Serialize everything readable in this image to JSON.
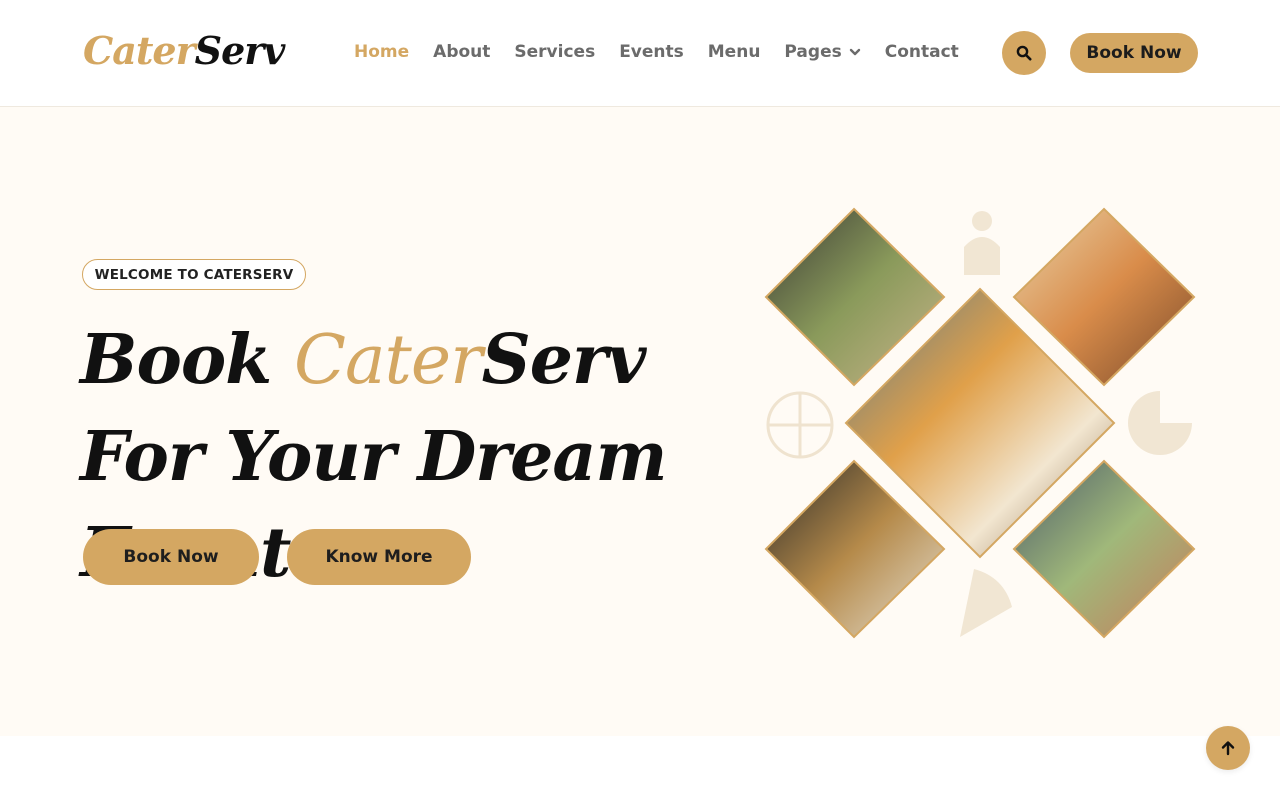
{
  "brand": {
    "logo_part1": "Cater",
    "logo_part2": "Serv"
  },
  "nav": {
    "items": [
      {
        "label": "Home",
        "active": true
      },
      {
        "label": "About"
      },
      {
        "label": "Services"
      },
      {
        "label": "Events"
      },
      {
        "label": "Menu"
      },
      {
        "label": "Pages",
        "dropdown": true
      },
      {
        "label": "Contact"
      }
    ],
    "book_label": "Book Now"
  },
  "hero": {
    "badge": "WELCOME TO CATERSERV",
    "headline_part1": "Book ",
    "headline_highlight": "Cater",
    "headline_part2": "Serv For Your Dream Event",
    "btn_book": "Book Now",
    "btn_know": "Know More"
  },
  "icons": {
    "search": "search-icon",
    "chevron": "chevron-down-icon",
    "scroll_top": "arrow-up-icon"
  },
  "colors": {
    "accent": "#d4a762",
    "hero_bg": "#fffbf5",
    "text_dark": "#111111",
    "nav_text": "#6b6b6b"
  }
}
